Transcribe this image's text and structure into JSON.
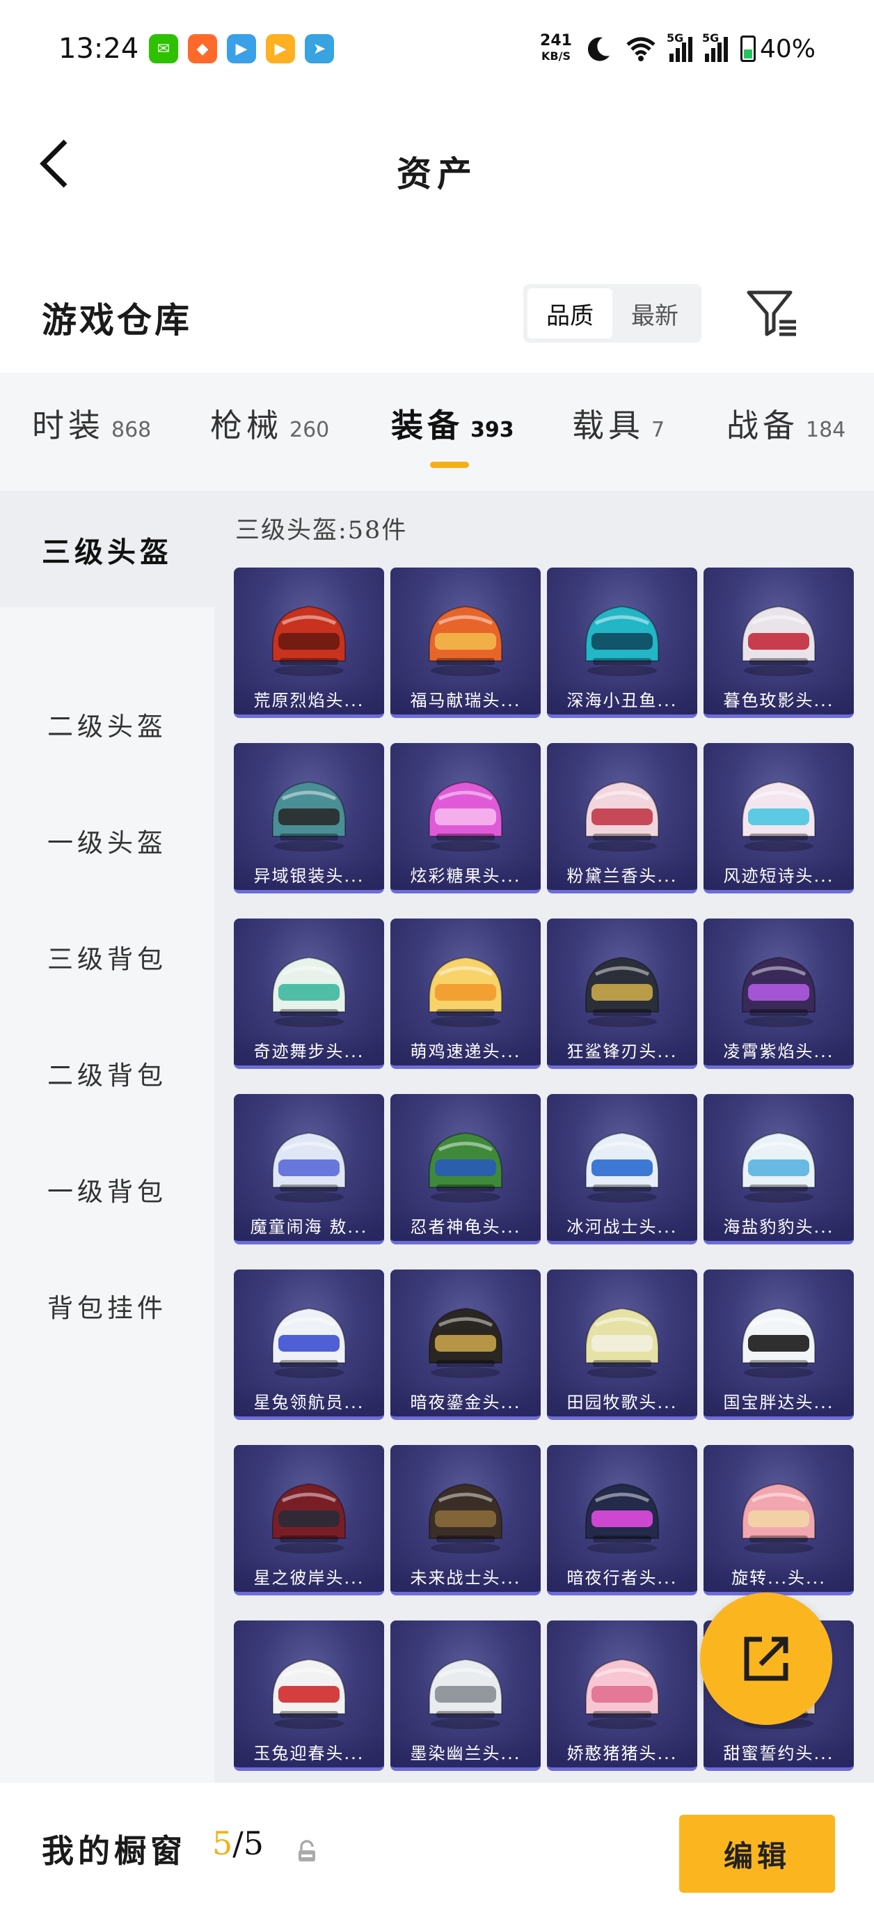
{
  "status_bar": {
    "time": "13:24",
    "net_speed_value": "241",
    "net_speed_unit": "KB/S",
    "signal_label_1": "5G",
    "signal_label_2": "5G",
    "battery": "40%",
    "apps": [
      {
        "name": "wechat-icon",
        "color": "#2dc100",
        "glyph": "✉"
      },
      {
        "name": "app-orange-icon",
        "color": "#ff6a2b",
        "glyph": "◆"
      },
      {
        "name": "game-icon",
        "color": "#3aa0e8",
        "glyph": "▶"
      },
      {
        "name": "video-icon",
        "color": "#ffb020",
        "glyph": "▶"
      },
      {
        "name": "telegram-icon",
        "color": "#37a3e0",
        "glyph": "➤"
      }
    ]
  },
  "header": {
    "title": "资产"
  },
  "warehouse": {
    "title": "游戏仓库",
    "sort_options": [
      "品质",
      "最新"
    ]
  },
  "tabs": [
    {
      "label": "时装",
      "count": "868"
    },
    {
      "label": "枪械",
      "count": "260"
    },
    {
      "label": "装备",
      "count": "393"
    },
    {
      "label": "载具",
      "count": "7"
    },
    {
      "label": "战备",
      "count": "184"
    }
  ],
  "sidebar": [
    {
      "label": "三级头盔"
    },
    {
      "label": "二级头盔"
    },
    {
      "label": "一级头盔"
    },
    {
      "label": "三级背包"
    },
    {
      "label": "二级背包"
    },
    {
      "label": "一级背包"
    },
    {
      "label": "背包挂件"
    }
  ],
  "grid": {
    "count_label": "三级头盔:58件",
    "items": [
      {
        "name": "荒原烈焰头...",
        "color": "#c8321e",
        "accent": "#6a1a10"
      },
      {
        "name": "福马献瑞头...",
        "color": "#e8652a",
        "accent": "#f2b84a"
      },
      {
        "name": "深海小丑鱼...",
        "color": "#22b6c6",
        "accent": "#0f4a60"
      },
      {
        "name": "暮色玫影头...",
        "color": "#e9e4ea",
        "accent": "#c42a3c"
      },
      {
        "name": "异域银装头...",
        "color": "#4a8f96",
        "accent": "#2a2a2a"
      },
      {
        "name": "炫彩糖果头...",
        "color": "#e05ad8",
        "accent": "#f7b7ee"
      },
      {
        "name": "粉黛兰香头...",
        "color": "#f2d6dd",
        "accent": "#c23a48"
      },
      {
        "name": "风迹短诗头...",
        "color": "#f3e6ef",
        "accent": "#4ac6e0"
      },
      {
        "name": "奇迹舞步头...",
        "color": "#e6f2ea",
        "accent": "#3fb8a0"
      },
      {
        "name": "萌鸡速递头...",
        "color": "#f7d36a",
        "accent": "#f29a2e"
      },
      {
        "name": "狂鲨锋刃头...",
        "color": "#2b2f3a",
        "accent": "#c9a94a"
      },
      {
        "name": "凌霄紫焰头...",
        "color": "#3a2a5a",
        "accent": "#b05ae0"
      },
      {
        "name": "魔童闹海 敖...",
        "color": "#dfe6f5",
        "accent": "#5a6ad8"
      },
      {
        "name": "忍者神龟头...",
        "color": "#3f8a3a",
        "accent": "#2a5ab8"
      },
      {
        "name": "冰河战士头...",
        "color": "#e6eef7",
        "accent": "#2a6ad0"
      },
      {
        "name": "海盐豹豹头...",
        "color": "#e9f2f7",
        "accent": "#5ab4e0"
      },
      {
        "name": "星兔领航员...",
        "color": "#eef1f7",
        "accent": "#3d4fd0"
      },
      {
        "name": "暗夜鎏金头...",
        "color": "#2a2622",
        "accent": "#c7a24a"
      },
      {
        "name": "田园牧歌头...",
        "color": "#e6e2a6",
        "accent": "#f2f0e0"
      },
      {
        "name": "国宝胖达头...",
        "color": "#f2f5f7",
        "accent": "#1a1a1a"
      },
      {
        "name": "星之彼岸头...",
        "color": "#7a1e26",
        "accent": "#2a2a3a"
      },
      {
        "name": "未来战士头...",
        "color": "#3a2e26",
        "accent": "#8a6a3a"
      },
      {
        "name": "暗夜行者头...",
        "color": "#232a4a",
        "accent": "#e04ae0"
      },
      {
        "name": "旋转...头...",
        "color": "#f2a6b0",
        "accent": "#f2d6a6"
      },
      {
        "name": "玉兔迎春头...",
        "color": "#f2f2f2",
        "accent": "#d02a2a"
      },
      {
        "name": "墨染幽兰头...",
        "color": "#e9ecef",
        "accent": "#8a8f96"
      },
      {
        "name": "娇憨猪猪头...",
        "color": "#f7c6d2",
        "accent": "#e07090"
      },
      {
        "name": "甜蜜誓约头...",
        "color": "#f2d9c6",
        "accent": "#e0a060"
      }
    ]
  },
  "bottom_bar": {
    "label": "我的橱窗",
    "current": "5",
    "separator": "/",
    "total": "5",
    "edit_label": "编辑"
  }
}
